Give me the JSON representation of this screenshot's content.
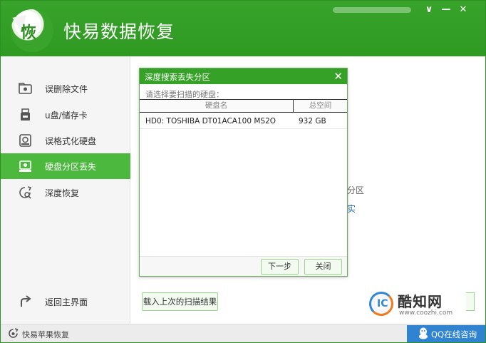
{
  "app": {
    "title": "快易数据恢复",
    "logo_char": "恢"
  },
  "window_controls": {
    "minimize": "∨",
    "restore": "—",
    "close": "✕"
  },
  "sidebar": {
    "items": [
      {
        "label": "误删除文件",
        "icon": "folder-icon",
        "active": false
      },
      {
        "label": "u盘/储存卡",
        "icon": "usb-drive-icon",
        "active": false
      },
      {
        "label": "误格式化硬盘",
        "icon": "hard-drive-icon",
        "active": false
      },
      {
        "label": "硬盘分区丢失",
        "icon": "partition-icon",
        "active": true
      },
      {
        "label": "深度恢复",
        "icon": "deep-recovery-icon",
        "active": false
      }
    ],
    "back_label": "返回主界面"
  },
  "main": {
    "partial_text_1": "分区",
    "partial_text_2": "实",
    "load_scan_button": "载入上次的扫描结果"
  },
  "dialog": {
    "title": "深度搜索丢失分区",
    "close": "✕",
    "prompt": "请选择要扫描的硬盘：",
    "columns": [
      "硬盘名",
      "总空间"
    ],
    "rows": [
      {
        "name": "HD0: TOSHIBA DT01ACA100 MS2O",
        "size": "932 GB"
      }
    ],
    "next_button": "下一步",
    "close_button": "关闭"
  },
  "bottombar": {
    "brand_label": "快易苹果恢复",
    "qq_label": "QQ在线咨询"
  },
  "watermark": {
    "logo_text": "IC",
    "name": "酷知网",
    "url": "www.coozhi.com"
  },
  "colors": {
    "brand_green": "#35a126",
    "active_nav": "#4cb83e",
    "qq_blue": "#2f83d1"
  }
}
